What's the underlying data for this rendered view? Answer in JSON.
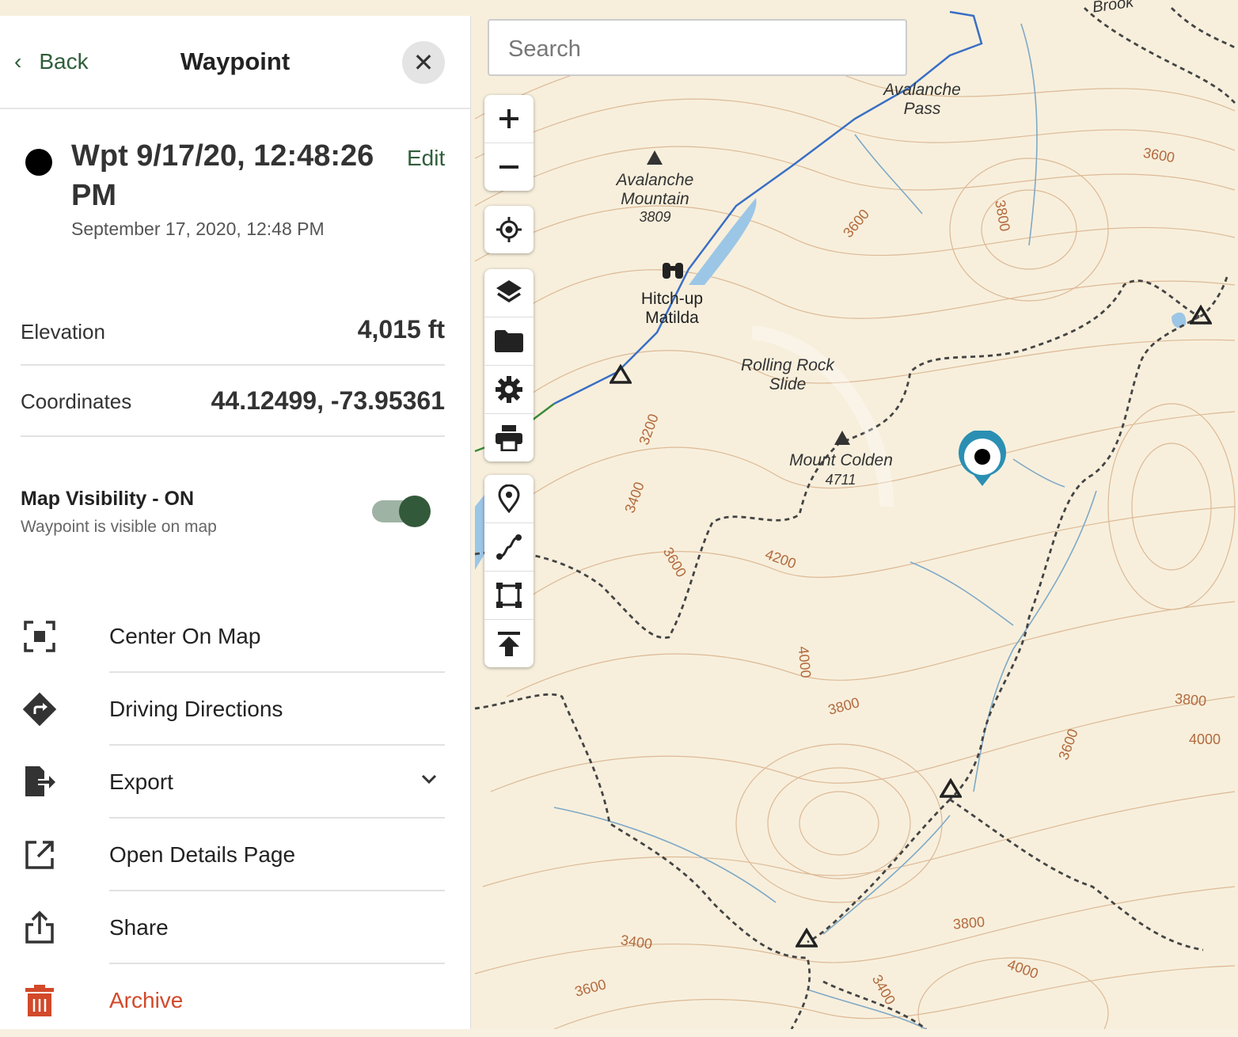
{
  "panel": {
    "back_label": "Back",
    "title": "Waypoint",
    "close_glyph": "✕",
    "waypoint_name": "Wpt 9/17/20, 12:48:26 PM",
    "edit_label": "Edit",
    "waypoint_date": "September 17, 2020, 12:48 PM",
    "elevation_label": "Elevation",
    "elevation_value": "4,015 ft",
    "coordinates_label": "Coordinates",
    "coordinates_value": "44.12499, -73.95361",
    "visibility_title": "Map Visibility - ON",
    "visibility_subtitle": "Waypoint is visible on map",
    "visibility_on": true,
    "actions": [
      {
        "label": "Center On Map",
        "icon": "center-focus-icon"
      },
      {
        "label": "Driving Directions",
        "icon": "directions-icon"
      },
      {
        "label": "Export",
        "icon": "export-icon"
      },
      {
        "label": "Open Details Page",
        "icon": "open-external-icon"
      },
      {
        "label": "Share",
        "icon": "share-icon"
      },
      {
        "label": "Archive",
        "icon": "trash-icon"
      }
    ]
  },
  "search": {
    "placeholder": "Search"
  },
  "toolbar": {
    "group1": [
      "zoom-in-icon",
      "zoom-out-icon"
    ],
    "group2": [
      "locate-icon"
    ],
    "group3": [
      "layers-icon",
      "folder-icon",
      "settings-icon",
      "print-icon"
    ],
    "group4": [
      "waypoint-icon",
      "route-icon",
      "area-icon",
      "upload-icon"
    ]
  },
  "map": {
    "labels": {
      "brook": "Brook",
      "avalanche_pass": "Avalanche Pass",
      "avalanche_mountain": "Avalanche Mountain",
      "avalanche_mountain_elev": "3809",
      "hitchup": "Hitch-up Matilda",
      "rolling": "Rolling Rock Slide",
      "colden": "Mount Colden",
      "colden_elev": "4711"
    },
    "contours": [
      "3600",
      "3800",
      "3600",
      "3200",
      "3400",
      "3600",
      "4200",
      "4000",
      "3800",
      "3800",
      "3600",
      "4000",
      "3800",
      "3400",
      "3600",
      "4000",
      "3400"
    ]
  },
  "colors": {
    "accent_green": "#2f5e3a",
    "archive_red": "#d2492a",
    "marker_blue": "#2b8fb3",
    "contour": "#c79a6e",
    "map_bg": "#f7efdc"
  }
}
